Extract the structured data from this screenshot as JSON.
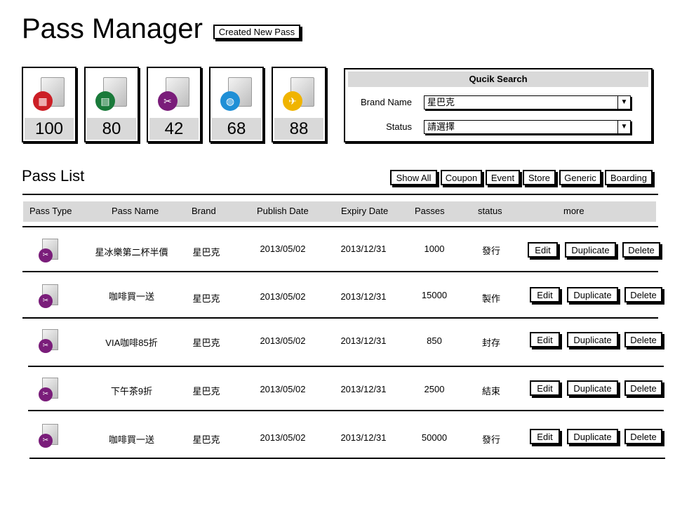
{
  "header": {
    "title": "Pass Manager",
    "new_pass_label": "Created New Pass"
  },
  "stats": [
    {
      "type": "event",
      "icon": "calendar-icon",
      "color": "#cc1f26",
      "glyph": "▦",
      "value": "100"
    },
    {
      "type": "coupon",
      "icon": "ticket-icon",
      "color": "#1a7a3a",
      "glyph": "▤",
      "value": "80"
    },
    {
      "type": "coupon-scissors",
      "icon": "scissors-icon",
      "color": "#7a1d7a",
      "glyph": "✂",
      "value": "42"
    },
    {
      "type": "generic",
      "icon": "globe-icon",
      "color": "#1f8fd6",
      "glyph": "◍",
      "value": "68"
    },
    {
      "type": "boarding",
      "icon": "airplane-icon",
      "color": "#f0b400",
      "glyph": "✈",
      "value": "88"
    }
  ],
  "quick_search": {
    "title": "Qucik Search",
    "brand_label": "Brand Name",
    "brand_value": "星巴克",
    "status_label": "Status",
    "status_value": "請選擇"
  },
  "pass_list": {
    "title": "Pass List",
    "filters": [
      "Show All",
      "Coupon",
      "Event",
      "Store",
      "Generic",
      "Boarding"
    ],
    "columns": [
      "Pass Type",
      "Pass Name",
      "Brand",
      "Publish Date",
      "Expiry Date",
      "Passes",
      "status",
      "more"
    ],
    "actions": [
      "Edit",
      "Duplicate",
      "Delete"
    ],
    "rows": [
      {
        "type_icon": "scissors-icon",
        "name": "星冰樂第二杯半價",
        "brand": "星巴克",
        "publish": "2013/05/02",
        "expiry": "2013/12/31",
        "passes": "1000",
        "status": "發行"
      },
      {
        "type_icon": "scissors-icon",
        "name": "咖啡買一送",
        "brand": "星巴克",
        "publish": "2013/05/02",
        "expiry": "2013/12/31",
        "passes": "15000",
        "status": "製作"
      },
      {
        "type_icon": "scissors-icon",
        "name": "VIA咖啡85折",
        "brand": "星巴克",
        "publish": "2013/05/02",
        "expiry": "2013/12/31",
        "passes": "850",
        "status": "封存"
      },
      {
        "type_icon": "scissors-icon",
        "name": "下午茶9折",
        "brand": "星巴克",
        "publish": "2013/05/02",
        "expiry": "2013/12/31",
        "passes": "2500",
        "status": "結束"
      },
      {
        "type_icon": "scissors-icon",
        "name": "咖啡買一送",
        "brand": "星巴克",
        "publish": "2013/05/02",
        "expiry": "2013/12/31",
        "passes": "50000",
        "status": "發行"
      }
    ]
  }
}
